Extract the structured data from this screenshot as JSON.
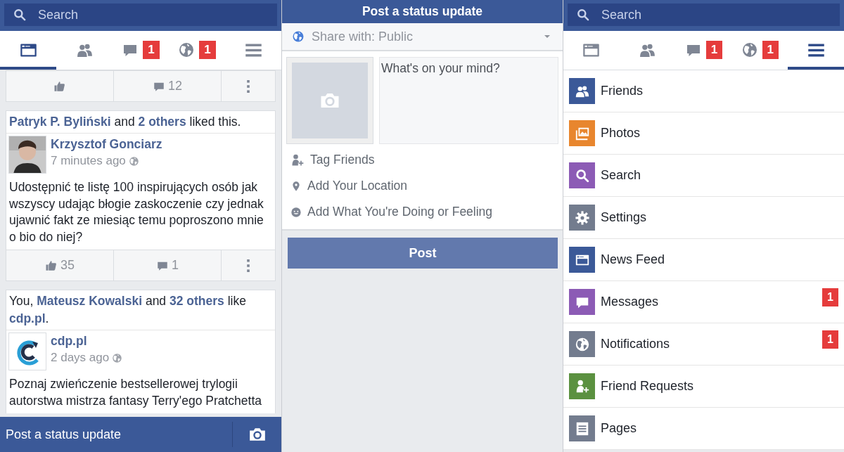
{
  "feed_screen": {
    "search": {
      "placeholder": "Search"
    },
    "tabs": [
      {
        "kind": "feed",
        "selected": true
      },
      {
        "kind": "friends",
        "selected": false
      },
      {
        "kind": "messages",
        "badge": "1",
        "selected": false
      },
      {
        "kind": "notifications",
        "badge": "1",
        "selected": false
      },
      {
        "kind": "menu",
        "selected": false
      }
    ],
    "top_actions": {
      "comments": "12"
    },
    "posts": [
      {
        "story": "**Patryk P. Byliński** and **2 others** liked this.",
        "author": "Krzysztof Gonciarz",
        "time": "7 minutes ago",
        "text": "Udostępnić te listę 100 inspirujących osób jak wszyscy udając błogie zaskoczenie czy jednak ujawnić fakt ze miesiąc temu poproszono mnie o bio do niej?",
        "likes": "35",
        "comments": "1"
      },
      {
        "story": "You, **Mateusz Kowalski** and **32 others** like **cdp.pl**.",
        "author": "cdp.pl",
        "time": "2 days ago",
        "text": "Poznaj zwieńczenie bestsellerowej trylogii autorstwa mistrza fantasy Terry'ego Pratchetta"
      }
    ],
    "bottom_bar": {
      "label": "Post a status update"
    }
  },
  "status_screen": {
    "title": "Post a status update",
    "share_with": "Share with: Public",
    "placeholder": "What's on your mind?",
    "options": [
      {
        "kind": "tag",
        "label": "Tag Friends"
      },
      {
        "kind": "location",
        "label": "Add Your Location"
      },
      {
        "kind": "feeling",
        "label": "Add What You're Doing or Feeling"
      }
    ],
    "post_button": "Post"
  },
  "menu_screen": {
    "search": {
      "placeholder": "Search"
    },
    "tabs": [
      {
        "kind": "feed",
        "selected": false
      },
      {
        "kind": "friends",
        "selected": false
      },
      {
        "kind": "messages",
        "badge": "1",
        "selected": false
      },
      {
        "kind": "notifications",
        "badge": "1",
        "selected": false
      },
      {
        "kind": "menu",
        "selected": true
      }
    ],
    "items": [
      {
        "kind": "friends",
        "label": "Friends",
        "color": "#3b5998"
      },
      {
        "kind": "photos",
        "label": "Photos",
        "color": "#e8862e"
      },
      {
        "kind": "search",
        "label": "Search",
        "color": "#8c5bb5"
      },
      {
        "kind": "settings",
        "label": "Settings",
        "color": "#737c8e"
      },
      {
        "kind": "feed",
        "label": "News Feed",
        "color": "#3b5998"
      },
      {
        "kind": "messages",
        "label": "Messages",
        "color": "#8c5bb5",
        "badge": "1"
      },
      {
        "kind": "notifications",
        "label": "Notifications",
        "color": "#737c8e",
        "badge": "1"
      },
      {
        "kind": "friend_requests",
        "label": "Friend Requests",
        "color": "#5b9140"
      },
      {
        "kind": "pages",
        "label": "Pages",
        "color": "#737c8e"
      }
    ]
  }
}
